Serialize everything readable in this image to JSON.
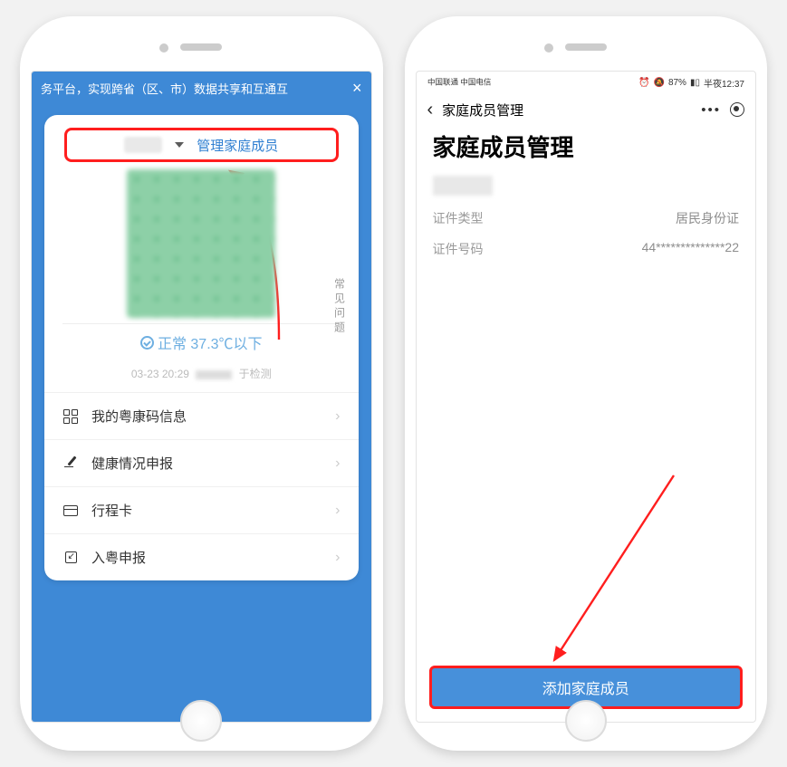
{
  "phone1": {
    "banner": "务平台，实现跨省（区、市）数据共享和互通互",
    "manage_link": "管理家庭成员",
    "faq_label": "常见问题",
    "status_text": "正常 37.3℃以下",
    "ts_date": "03-23 20:29",
    "ts_suffix": "于检测",
    "menu": {
      "m1": "我的粤康码信息",
      "m2": "健康情况申报",
      "m3": "行程卡",
      "m4": "入粤申报"
    }
  },
  "phone2": {
    "carrier": "中国联通 中国电信",
    "battery": "87%",
    "time": "半夜12:37",
    "nav_title": "家庭成员管理",
    "page_title": "家庭成员管理",
    "id_type_label": "证件类型",
    "id_type_value": "居民身份证",
    "id_num_label": "证件号码",
    "id_num_value": "44**************22",
    "add_button": "添加家庭成员"
  }
}
